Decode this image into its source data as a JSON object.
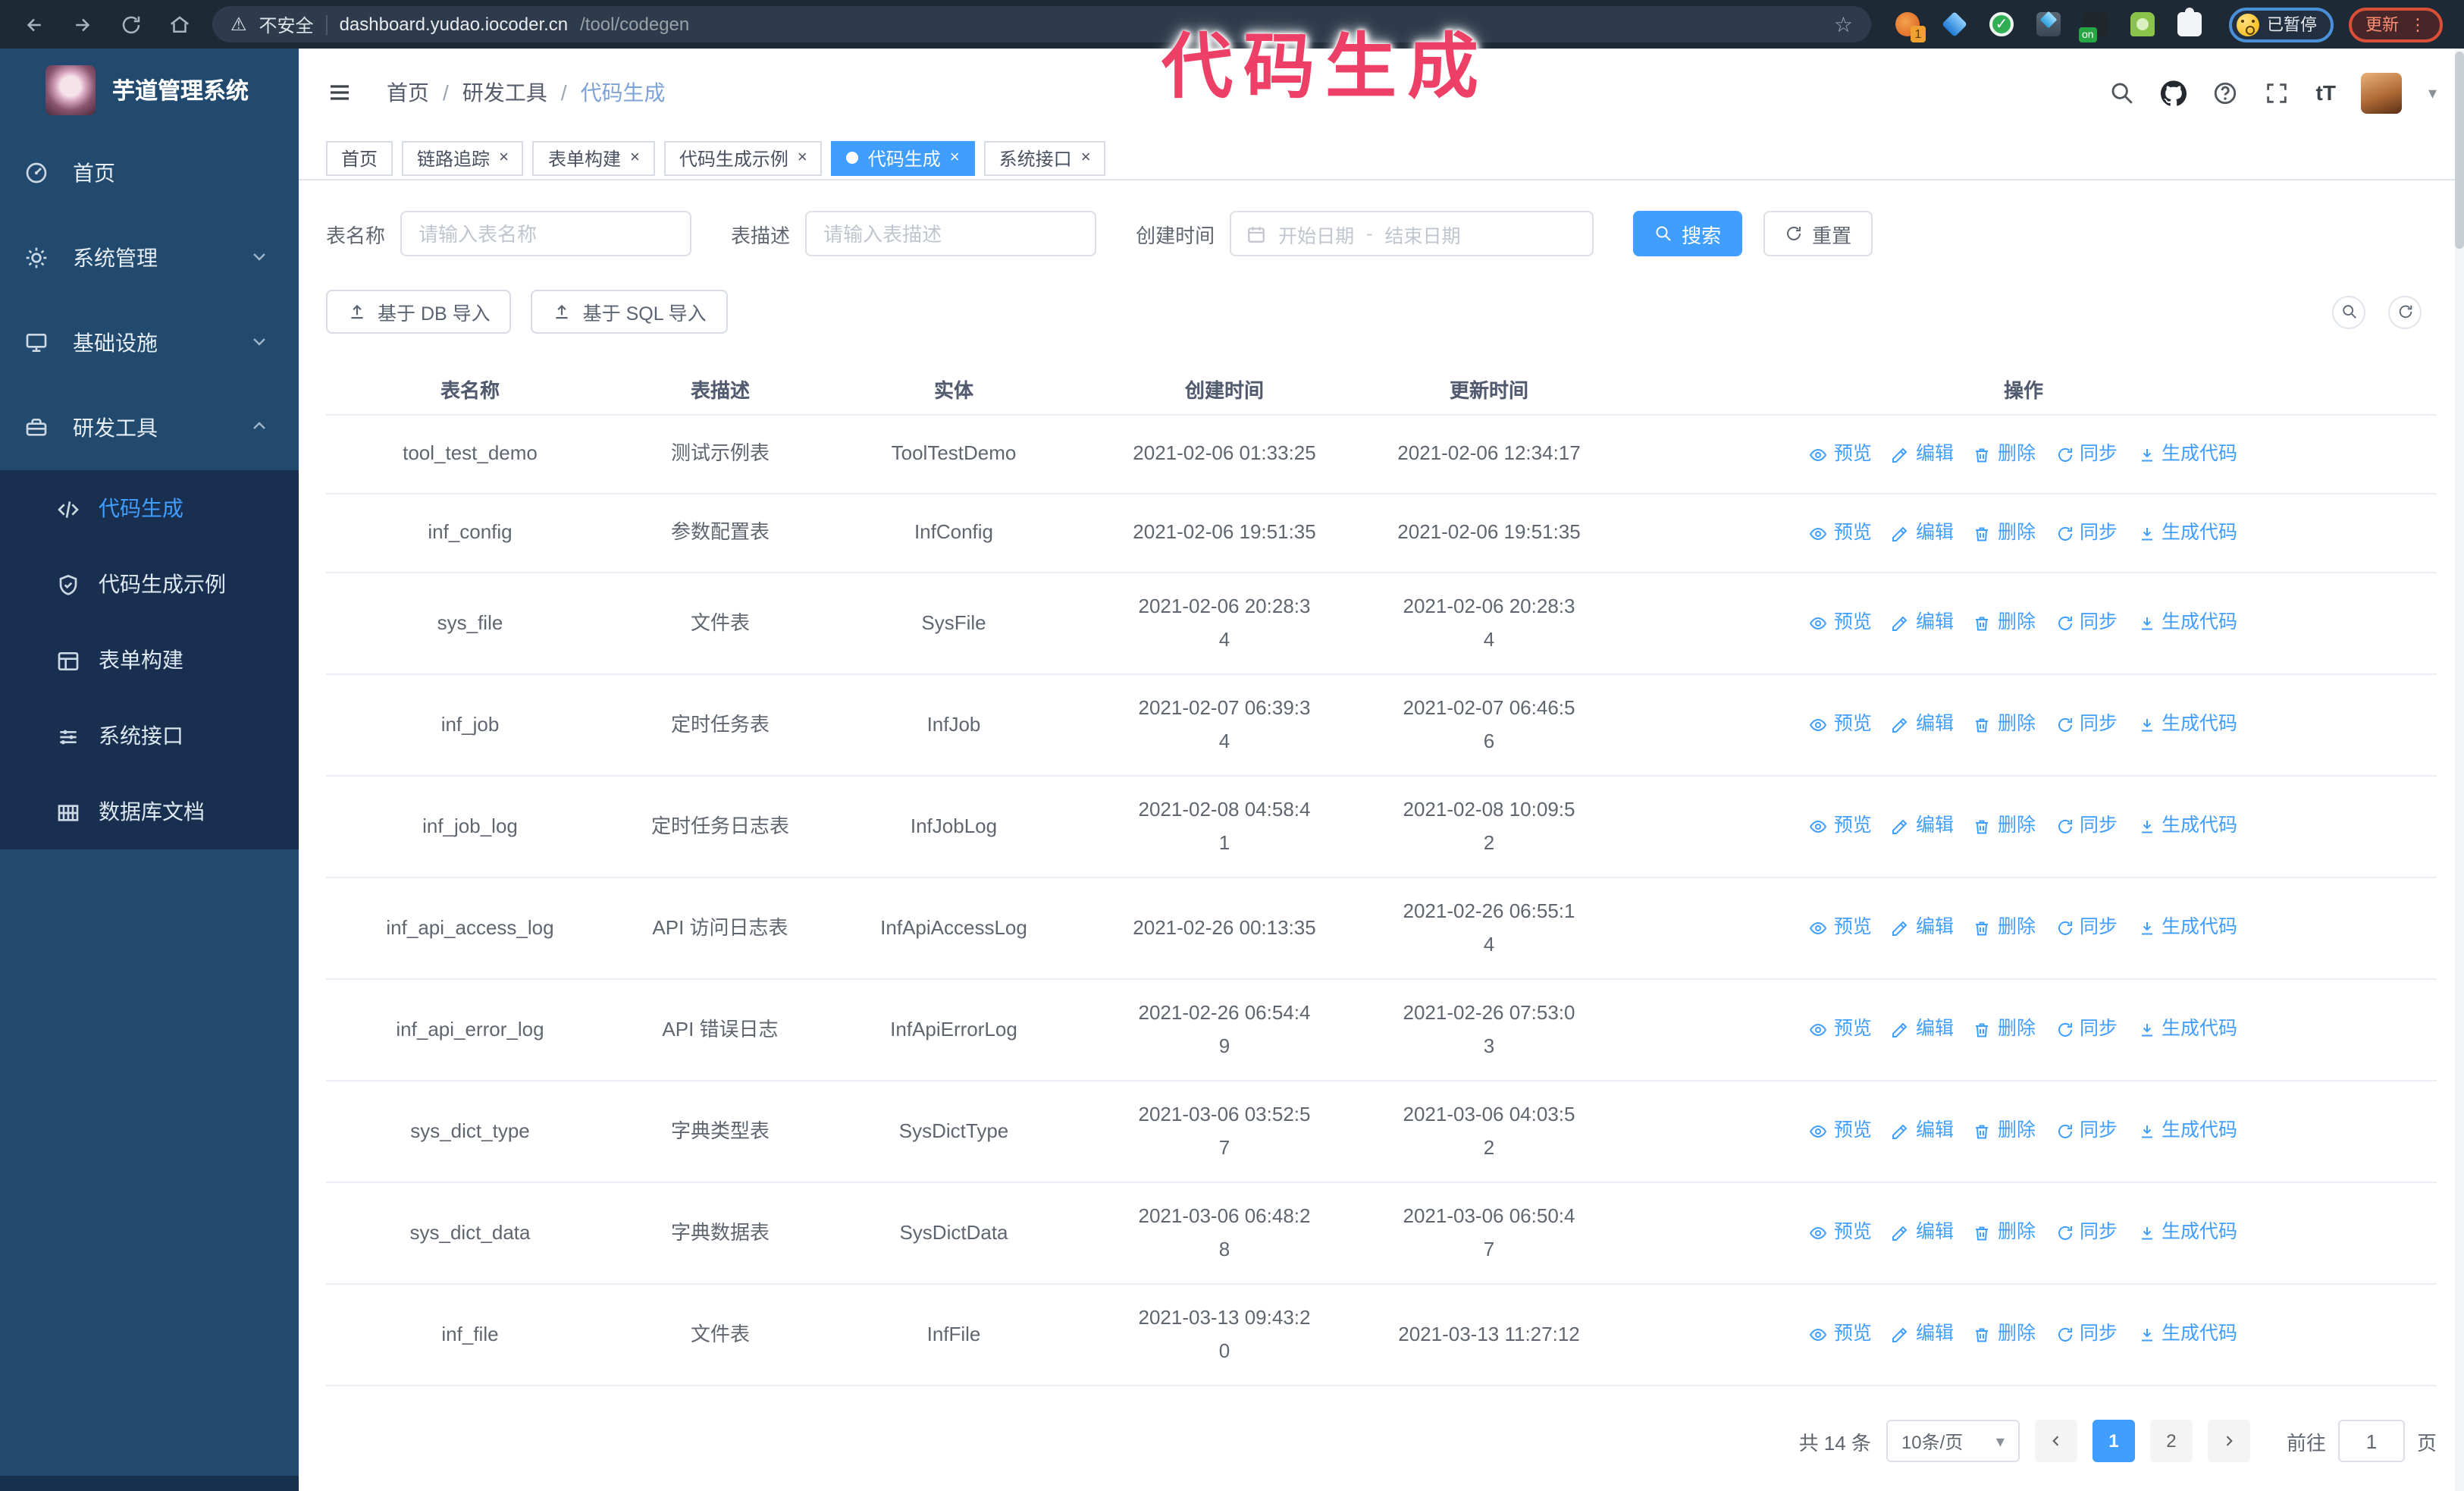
{
  "browser": {
    "security_label": "不安全",
    "url_host": "dashboard.yudao.iocoder.cn",
    "url_path": "/tool/codegen",
    "profile_badge": "已暂停",
    "update_label": "更新"
  },
  "annotation": {
    "text": "代码生成",
    "color": "#ee3f66"
  },
  "icons": {
    "warning": "⚠",
    "star": "☆",
    "caret_down": "▾",
    "overflow_dots": "⋮",
    "font_size": "tT",
    "close": "×",
    "check": "✓",
    "ext_badge_1": "1",
    "ext_badge_on": "on"
  },
  "sidebar": {
    "brand_title": "芋道管理系统",
    "items": [
      {
        "label": "首页"
      },
      {
        "label": "系统管理"
      },
      {
        "label": "基础设施"
      },
      {
        "label": "研发工具"
      }
    ],
    "submenu": [
      {
        "label": "代码生成"
      },
      {
        "label": "代码生成示例"
      },
      {
        "label": "表单构建"
      },
      {
        "label": "系统接口"
      },
      {
        "label": "数据库文档"
      }
    ]
  },
  "header": {
    "breadcrumb": {
      "items": [
        "首页",
        "研发工具",
        "代码生成"
      ],
      "separator": "/"
    }
  },
  "tabs": [
    {
      "label": "首页"
    },
    {
      "label": "链路追踪"
    },
    {
      "label": "表单构建"
    },
    {
      "label": "代码生成示例"
    },
    {
      "label": "代码生成"
    },
    {
      "label": "系统接口"
    }
  ],
  "filters": {
    "table_name_label": "表名称",
    "table_name_placeholder": "请输入表名称",
    "table_desc_label": "表描述",
    "table_desc_placeholder": "请输入表描述",
    "create_time_label": "创建时间",
    "date_start_placeholder": "开始日期",
    "date_separator": "-",
    "date_end_placeholder": "结束日期",
    "search_label": "搜索",
    "reset_label": "重置"
  },
  "toolbar": {
    "import_db_label": "基于 DB 导入",
    "import_sql_label": "基于 SQL 导入"
  },
  "table": {
    "columns": [
      "表名称",
      "表描述",
      "实体",
      "创建时间",
      "更新时间",
      "操作"
    ],
    "actions": [
      "预览",
      "编辑",
      "删除",
      "同步",
      "生成代码"
    ],
    "rows": [
      {
        "name": "tool_test_demo",
        "desc": "测试示例表",
        "entity": "ToolTestDemo",
        "created": "2021-02-06 01:33:25",
        "updated": "2021-02-06 12:34:17"
      },
      {
        "name": "inf_config",
        "desc": "参数配置表",
        "entity": "InfConfig",
        "created": "2021-02-06 19:51:35",
        "updated": "2021-02-06 19:51:35"
      },
      {
        "name": "sys_file",
        "desc": "文件表",
        "entity": "SysFile",
        "created": "2021-02-06 20:28:3\n4",
        "updated": "2021-02-06 20:28:3\n4"
      },
      {
        "name": "inf_job",
        "desc": "定时任务表",
        "entity": "InfJob",
        "created": "2021-02-07 06:39:3\n4",
        "updated": "2021-02-07 06:46:5\n6"
      },
      {
        "name": "inf_job_log",
        "desc": "定时任务日志表",
        "entity": "InfJobLog",
        "created": "2021-02-08 04:58:4\n1",
        "updated": "2021-02-08 10:09:5\n2"
      },
      {
        "name": "inf_api_access_log",
        "desc": "API 访问日志表",
        "entity": "InfApiAccessLog",
        "created": "2021-02-26 00:13:35",
        "updated": "2021-02-26 06:55:1\n4"
      },
      {
        "name": "inf_api_error_log",
        "desc": "API 错误日志",
        "entity": "InfApiErrorLog",
        "created": "2021-02-26 06:54:4\n9",
        "updated": "2021-02-26 07:53:0\n3"
      },
      {
        "name": "sys_dict_type",
        "desc": "字典类型表",
        "entity": "SysDictType",
        "created": "2021-03-06 03:52:5\n7",
        "updated": "2021-03-06 04:03:5\n2"
      },
      {
        "name": "sys_dict_data",
        "desc": "字典数据表",
        "entity": "SysDictData",
        "created": "2021-03-06 06:48:2\n8",
        "updated": "2021-03-06 06:50:4\n7"
      },
      {
        "name": "inf_file",
        "desc": "文件表",
        "entity": "InfFile",
        "created": "2021-03-13 09:43:2\n0",
        "updated": "2021-03-13 11:27:12"
      }
    ]
  },
  "pagination": {
    "total_label": "共 14 条",
    "page_size_label": "10条/页",
    "page_1": "1",
    "page_2": "2",
    "goto_label": "前往",
    "goto_value": "1",
    "goto_suffix": "页"
  },
  "colors": {
    "accent_blue": "#409eff",
    "sidebar_bg": "#214a6e",
    "submenu_bg": "#182f50",
    "chrome_bg": "#1d2935",
    "annotation_pink": "#ee3f66"
  }
}
